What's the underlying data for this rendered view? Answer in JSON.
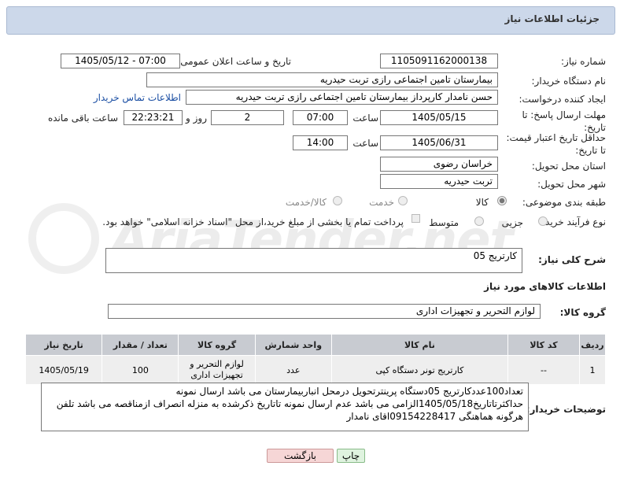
{
  "header": {
    "title": "جزئیات اطلاعات نیاز"
  },
  "form": {
    "need_number_label": "شماره نیاز:",
    "need_number": "1105091162000138",
    "announce_label": "تاریخ و ساعت اعلان عمومی:",
    "announce_value": "1405/05/12 - 07:00",
    "buyer_org_label": "نام دستگاه خریدار:",
    "buyer_org": "بیمارستان تامین اجتماعی رازی تربت حیدریه",
    "requester_label": "ایجاد کننده درخواست:",
    "requester": "حسن نامدار کارپرداز بیمارستان تامین اجتماعی رازی تربت حیدریه",
    "contact_link": "اطلاعات تماس خریدار",
    "deadline_label_1": "مهلت ارسال پاسخ: تا",
    "deadline_label_2": "تاریخ:",
    "deadline_date": "1405/05/15",
    "time_label": "ساعت",
    "deadline_time": "07:00",
    "days_value": "2",
    "days_label": "روز و",
    "remaining_time": "22:23:21",
    "remaining_label": "ساعت باقی مانده",
    "validity_label_1": "حداقل تاریخ اعتبار قیمت:",
    "validity_label_2": "تا تاریخ:",
    "validity_date": "1405/06/31",
    "validity_time": "14:00",
    "province_label": "استان محل تحویل:",
    "province": "خراسان رضوی",
    "city_label": "شهر محل تحویل:",
    "city": "تربت حیدریه",
    "category_label": "طبقه بندی موضوعی:",
    "category_options": [
      "کالا",
      "خدمت",
      "کالا/خدمت"
    ],
    "category_selected": "کالا",
    "process_label": "نوع فرآیند خرید :",
    "process_options": [
      "جزیی",
      "متوسط"
    ],
    "payment_note": "پرداخت تمام یا بخشی از مبلغ خرید،از محل \"اسناد خزانه اسلامی\" خواهد بود.",
    "description_label": "شرح کلی نیاز:",
    "description": "کارتریج 05",
    "goods_info_title": "اطلاعات کالاهای مورد نیاز",
    "goods_group_label": "گروه کالا:",
    "goods_group": "لوازم التحریر و تجهیزات اداری"
  },
  "table": {
    "headers": [
      "ردیف",
      "کد کالا",
      "نام کالا",
      "واحد شمارش",
      "گروه کالا",
      "تعداد / مقدار",
      "تاریخ نیاز"
    ],
    "rows": [
      {
        "index": "1",
        "code": "--",
        "name": "کارتریج تونر دستگاه کپی",
        "unit": "عدد",
        "group": "لوازم التحریر و تجهیزات اداری",
        "qty": "100",
        "date": "1405/05/19"
      }
    ]
  },
  "buyer_notes": {
    "label": "توضیحات خریدار:",
    "text": "تعداد100عددکارتریج 05دستگاه پرینترتحویل درمحل انباربیمارستان می باشد ارسال نمونه حداکثرتاتاریخ1405/05/18الزامی می باشد عدم ارسال نمونه تاتاریخ ذکرشده به منزله انصراف ازمناقصه می باشد تلفن هرگونه هماهنگی 09154228417اقای نامدار"
  },
  "buttons": {
    "print": "چاپ",
    "back": "بازگشت"
  },
  "watermark": "AriaTender.net",
  "colors": {
    "title_bg": "#ccd8ea",
    "table_header": "#c8cbd1",
    "link": "#1a4ea3",
    "back_btn": "#f6d6d6",
    "print_btn": "#dff3df"
  }
}
